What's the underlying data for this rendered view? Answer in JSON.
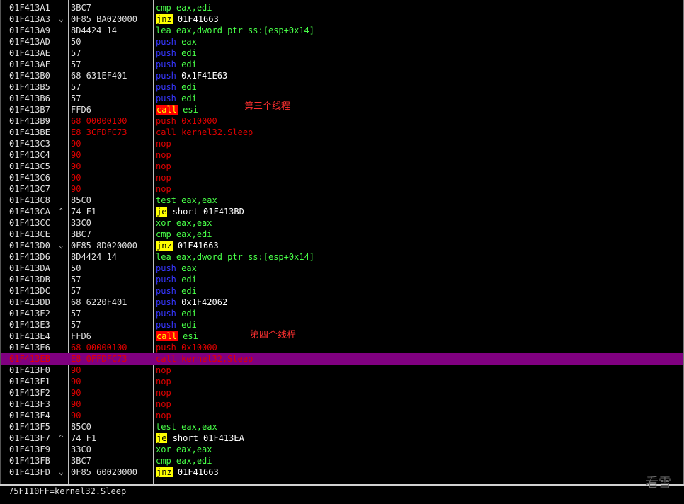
{
  "colors": {
    "background": "#000000",
    "selection": "#800080",
    "address": "#e0e0e0",
    "annotation": "#ff3030"
  },
  "rows": [
    {
      "addr": "01F413A1",
      "arrow": "",
      "hex": "3BC7",
      "op": "cmp",
      "opc": "green",
      "args": "eax,edi",
      "argc": "green"
    },
    {
      "addr": "01F413A3",
      "arrow": "⌄",
      "hex": "0F85 BA020000",
      "op": "jnz",
      "opc": "jmp",
      "args": "01F41663",
      "argc": "white"
    },
    {
      "addr": "01F413A9",
      "arrow": "",
      "hex": "8D4424 14",
      "op": "lea",
      "opc": "green",
      "args": "eax,dword ptr ss:[esp+0x14]",
      "argc": "green"
    },
    {
      "addr": "01F413AD",
      "arrow": "",
      "hex": "50",
      "op": "push",
      "opc": "blue",
      "args": "eax",
      "argc": "green"
    },
    {
      "addr": "01F413AE",
      "arrow": "",
      "hex": "57",
      "op": "push",
      "opc": "blue",
      "args": "edi",
      "argc": "green"
    },
    {
      "addr": "01F413AF",
      "arrow": "",
      "hex": "57",
      "op": "push",
      "opc": "blue",
      "args": "edi",
      "argc": "green"
    },
    {
      "addr": "01F413B0",
      "arrow": "",
      "hex": "68 631EF401",
      "op": "push",
      "opc": "blue",
      "args": "0x1F41E63",
      "argc": "white"
    },
    {
      "addr": "01F413B5",
      "arrow": "",
      "hex": "57",
      "op": "push",
      "opc": "blue",
      "args": "edi",
      "argc": "green"
    },
    {
      "addr": "01F413B6",
      "arrow": "",
      "hex": "57",
      "op": "push",
      "opc": "blue",
      "args": "edi",
      "argc": "green"
    },
    {
      "addr": "01F413B7",
      "arrow": "",
      "hex": "FFD6",
      "op": "call",
      "opc": "call",
      "args": "esi",
      "argc": "green"
    },
    {
      "addr": "01F413B9",
      "arrow": "",
      "hex": "68 00000100",
      "op": "push",
      "opc": "red",
      "args": "0x10000",
      "argc": "red",
      "hexred": true
    },
    {
      "addr": "01F413BE",
      "arrow": "",
      "hex": "E8 3CFDFC73",
      "op": "call",
      "opc": "red",
      "args": "kernel32.Sleep",
      "argc": "red",
      "hexred": true
    },
    {
      "addr": "01F413C3",
      "arrow": "",
      "hex": "90",
      "op": "nop",
      "opc": "red",
      "args": "",
      "argc": "red",
      "hexred": true
    },
    {
      "addr": "01F413C4",
      "arrow": "",
      "hex": "90",
      "op": "nop",
      "opc": "red",
      "args": "",
      "argc": "red",
      "hexred": true
    },
    {
      "addr": "01F413C5",
      "arrow": "",
      "hex": "90",
      "op": "nop",
      "opc": "red",
      "args": "",
      "argc": "red",
      "hexred": true
    },
    {
      "addr": "01F413C6",
      "arrow": "",
      "hex": "90",
      "op": "nop",
      "opc": "red",
      "args": "",
      "argc": "red",
      "hexred": true
    },
    {
      "addr": "01F413C7",
      "arrow": "",
      "hex": "90",
      "op": "nop",
      "opc": "red",
      "args": "",
      "argc": "red",
      "hexred": true
    },
    {
      "addr": "01F413C8",
      "arrow": "",
      "hex": "85C0",
      "op": "test",
      "opc": "green",
      "args": "eax,eax",
      "argc": "green"
    },
    {
      "addr": "01F413CA",
      "arrow": "^",
      "hex": "74 F1",
      "op": "je",
      "opc": "jmp",
      "args": "short 01F413BD",
      "argc": "white"
    },
    {
      "addr": "01F413CC",
      "arrow": "",
      "hex": "33C0",
      "op": "xor",
      "opc": "green",
      "args": "eax,eax",
      "argc": "green"
    },
    {
      "addr": "01F413CE",
      "arrow": "",
      "hex": "3BC7",
      "op": "cmp",
      "opc": "green",
      "args": "eax,edi",
      "argc": "green"
    },
    {
      "addr": "01F413D0",
      "arrow": "⌄",
      "hex": "0F85 8D020000",
      "op": "jnz",
      "opc": "jmp",
      "args": "01F41663",
      "argc": "white"
    },
    {
      "addr": "01F413D6",
      "arrow": "",
      "hex": "8D4424 14",
      "op": "lea",
      "opc": "green",
      "args": "eax,dword ptr ss:[esp+0x14]",
      "argc": "green"
    },
    {
      "addr": "01F413DA",
      "arrow": "",
      "hex": "50",
      "op": "push",
      "opc": "blue",
      "args": "eax",
      "argc": "green"
    },
    {
      "addr": "01F413DB",
      "arrow": "",
      "hex": "57",
      "op": "push",
      "opc": "blue",
      "args": "edi",
      "argc": "green"
    },
    {
      "addr": "01F413DC",
      "arrow": "",
      "hex": "57",
      "op": "push",
      "opc": "blue",
      "args": "edi",
      "argc": "green"
    },
    {
      "addr": "01F413DD",
      "arrow": "",
      "hex": "68 6220F401",
      "op": "push",
      "opc": "blue",
      "args": "0x1F42062",
      "argc": "white"
    },
    {
      "addr": "01F413E2",
      "arrow": "",
      "hex": "57",
      "op": "push",
      "opc": "blue",
      "args": "edi",
      "argc": "green"
    },
    {
      "addr": "01F413E3",
      "arrow": "",
      "hex": "57",
      "op": "push",
      "opc": "blue",
      "args": "edi",
      "argc": "green"
    },
    {
      "addr": "01F413E4",
      "arrow": "",
      "hex": "FFD6",
      "op": "call",
      "opc": "call",
      "args": "esi",
      "argc": "green"
    },
    {
      "addr": "01F413E6",
      "arrow": "",
      "hex": "68 00000100",
      "op": "push",
      "opc": "red",
      "args": "0x10000",
      "argc": "red",
      "hexred": true
    },
    {
      "addr": "01F413EB",
      "arrow": "",
      "hex": "E8 0FFDFC73",
      "op": "call",
      "opc": "red",
      "args": "kernel32.Sleep",
      "argc": "red",
      "hexred": true,
      "selected": true
    },
    {
      "addr": "01F413F0",
      "arrow": "",
      "hex": "90",
      "op": "nop",
      "opc": "red",
      "args": "",
      "argc": "red",
      "hexred": true
    },
    {
      "addr": "01F413F1",
      "arrow": "",
      "hex": "90",
      "op": "nop",
      "opc": "red",
      "args": "",
      "argc": "red",
      "hexred": true
    },
    {
      "addr": "01F413F2",
      "arrow": "",
      "hex": "90",
      "op": "nop",
      "opc": "red",
      "args": "",
      "argc": "red",
      "hexred": true
    },
    {
      "addr": "01F413F3",
      "arrow": "",
      "hex": "90",
      "op": "nop",
      "opc": "red",
      "args": "",
      "argc": "red",
      "hexred": true
    },
    {
      "addr": "01F413F4",
      "arrow": "",
      "hex": "90",
      "op": "nop",
      "opc": "red",
      "args": "",
      "argc": "red",
      "hexred": true
    },
    {
      "addr": "01F413F5",
      "arrow": "",
      "hex": "85C0",
      "op": "test",
      "opc": "green",
      "args": "eax,eax",
      "argc": "green"
    },
    {
      "addr": "01F413F7",
      "arrow": "^",
      "hex": "74 F1",
      "op": "je",
      "opc": "jmp",
      "args": "short 01F413EA",
      "argc": "white"
    },
    {
      "addr": "01F413F9",
      "arrow": "",
      "hex": "33C0",
      "op": "xor",
      "opc": "green",
      "args": "eax,eax",
      "argc": "green"
    },
    {
      "addr": "01F413FB",
      "arrow": "",
      "hex": "3BC7",
      "op": "cmp",
      "opc": "green",
      "args": "eax,edi",
      "argc": "green"
    },
    {
      "addr": "01F413FD",
      "arrow": "⌄",
      "hex": "0F85 60020000",
      "op": "jnz",
      "opc": "jmp",
      "args": "01F41663",
      "argc": "white"
    }
  ],
  "annotations": {
    "third": "第三个线程",
    "fourth": "第四个线程"
  },
  "status": {
    "text": "75F110FF=kernel32.Sleep"
  },
  "watermark": "看雪"
}
